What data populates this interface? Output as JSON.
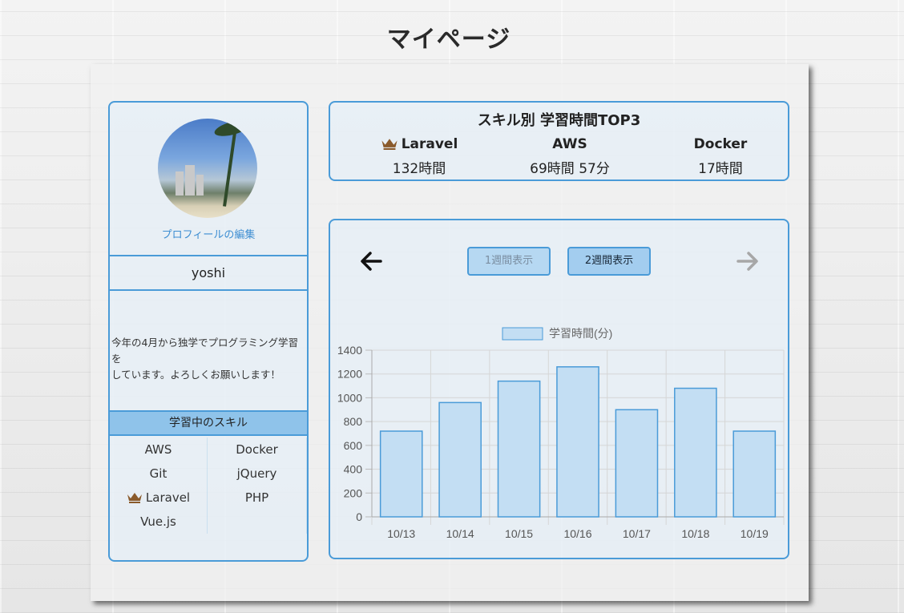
{
  "page": {
    "title": "マイページ"
  },
  "profile": {
    "edit_link": "プロフィールの編集",
    "username": "yoshi",
    "bio_lines": [
      "今年の4月から独学でプログラミング学習を",
      "しています。よろしくお願いします！"
    ],
    "skills_header": "学習中のスキル",
    "skills": [
      {
        "name": "AWS",
        "crown": false
      },
      {
        "name": "Docker",
        "crown": false
      },
      {
        "name": "Git",
        "crown": false
      },
      {
        "name": "jQuery",
        "crown": false
      },
      {
        "name": "Laravel",
        "crown": true
      },
      {
        "name": "PHP",
        "crown": false
      },
      {
        "name": "Vue.js",
        "crown": false
      }
    ]
  },
  "top3": {
    "title": "スキル別 学習時間TOP3",
    "items": [
      {
        "name": "Laravel",
        "time": "132時間",
        "crown": true
      },
      {
        "name": "AWS",
        "time": "69時間 57分",
        "crown": false
      },
      {
        "name": "Docker",
        "time": "17時間",
        "crown": false
      }
    ]
  },
  "chart_controls": {
    "prev_icon": "arrow-left-icon",
    "next_icon": "arrow-right-icon",
    "week1_label": "1週間表示",
    "week2_label": "2週間表示"
  },
  "colors": {
    "accent": "#4a9bd8",
    "bar_fill": "#c3def3",
    "bar_stroke": "#4a9bd8",
    "crown": "#8a5a2b"
  },
  "chart_data": {
    "type": "bar",
    "categories": [
      "10/13",
      "10/14",
      "10/15",
      "10/16",
      "10/17",
      "10/18",
      "10/19"
    ],
    "series": [
      {
        "name": "学習時間(分)",
        "values": [
          720,
          960,
          1140,
          1260,
          900,
          1080,
          720
        ]
      }
    ],
    "ylim": [
      0,
      1400
    ],
    "yticks": [
      0,
      200,
      400,
      600,
      800,
      1000,
      1200,
      1400
    ],
    "legend": "top-center",
    "grid": true
  }
}
